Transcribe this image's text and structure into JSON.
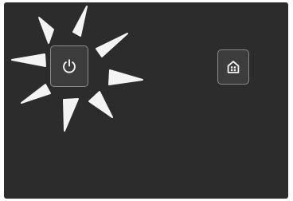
{
  "colors": {
    "screen_bg": "#2c2c2c",
    "button_bg": "#3c3c3c",
    "button_border": "#8a8a8a",
    "icon_color": "#f2f2f2",
    "ray_color": "#f4f4f4"
  },
  "buttons": {
    "power": {
      "icon": "power-icon",
      "state": "highlighted"
    },
    "home": {
      "icon": "home-icon"
    }
  }
}
